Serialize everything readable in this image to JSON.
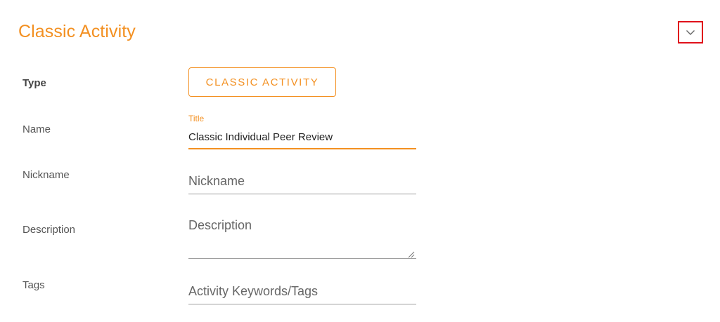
{
  "section": {
    "title": "Classic Activity"
  },
  "accent_color": "#f39021",
  "highlight_color": "#e0111b",
  "collapse_icon": "chevron-down-icon",
  "form": {
    "type": {
      "label": "Type",
      "button_label": "CLASSIC ACTIVITY"
    },
    "name": {
      "label": "Name",
      "floating_label": "Title",
      "value": "Classic Individual Peer Review"
    },
    "nickname": {
      "label": "Nickname",
      "value": "",
      "placeholder": "Nickname"
    },
    "description": {
      "label": "Description",
      "value": "",
      "placeholder": "Description"
    },
    "tags": {
      "label": "Tags",
      "value": "",
      "placeholder": "Activity Keywords/Tags"
    }
  }
}
